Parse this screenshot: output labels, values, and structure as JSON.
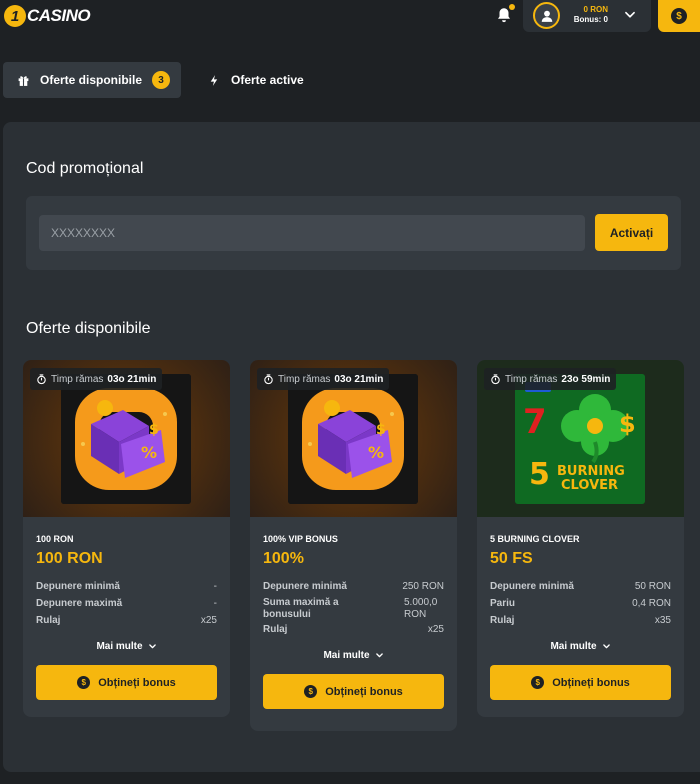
{
  "header": {
    "logo_digit": "1",
    "logo_text": "CASINO",
    "balance_amount": "0 RON",
    "bonus_label": "Bonus:",
    "bonus_value": "0",
    "deposit_icon": "$"
  },
  "tabs": [
    {
      "label": "Oferte disponibile",
      "count": "3",
      "icon": "gift-icon"
    },
    {
      "label": "Oferte active",
      "icon": "lightning-icon"
    }
  ],
  "promo": {
    "title": "Cod promoțional",
    "placeholder": "XXXXXXXX",
    "button": "Activați"
  },
  "offers_title": "Oferte disponibile",
  "cards": [
    {
      "timer_label": "Timp rămas",
      "timer_value": "03o 21min",
      "name": "100 RON",
      "amount": "100 RON",
      "rows": [
        {
          "label": "Depunere minimă",
          "value": "-"
        },
        {
          "label": "Depunere maximă",
          "value": "-"
        },
        {
          "label": "Rulaj",
          "value": "x25"
        }
      ],
      "more": "Mai multe",
      "button": "Obțineți bonus",
      "image": "gift-box-illustration"
    },
    {
      "timer_label": "Timp rămas",
      "timer_value": "03o 21min",
      "name": "100% VIP BONUS",
      "amount": "100%",
      "rows": [
        {
          "label": "Depunere minimă",
          "value": "250 RON"
        },
        {
          "label": "Suma maximă a bonusului",
          "value": "5.000,0 RON"
        },
        {
          "label": "Rulaj",
          "value": "x25"
        }
      ],
      "more": "Mai multe",
      "button": "Obțineți bonus",
      "image": "gift-box-illustration"
    },
    {
      "timer_label": "Timp rămas",
      "timer_value": "23o 59min",
      "name": "5 BURNING CLOVER",
      "amount": "50 FS",
      "rows": [
        {
          "label": "Depunere minimă",
          "value": "50 RON"
        },
        {
          "label": "Pariu",
          "value": "0,4 RON"
        },
        {
          "label": "Rulaj",
          "value": "x35"
        }
      ],
      "more": "Mai multe",
      "button": "Obțineți bonus",
      "image": "5-burning-clover-slot",
      "image_text_1": "5",
      "image_text_2": "BURNING",
      "image_text_3": "CLOVER",
      "image_text_4": "7",
      "image_text_5": "$"
    }
  ],
  "colors": {
    "accent": "#f6b70e",
    "background": "#1e2124",
    "panel": "#2b3035",
    "card": "#343a40"
  }
}
